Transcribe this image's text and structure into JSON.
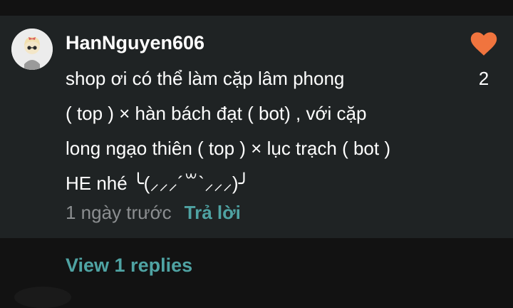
{
  "comment": {
    "username": "HanNguyen606",
    "body_lines": [
      "shop ơi có thể làm cặp lâm phong",
      "( top ) × hàn bách đạt ( bot) , với cặp",
      "long ngạo thiên ( top ) × lục trạch ( bot )",
      "HE nhé  ╰(⸝⸝⸝´꒳`⸝⸝⸝)╯"
    ],
    "timestamp": "1 ngày trước",
    "reply_label": "Trả lời",
    "like_count": "2",
    "view_replies_label": "View 1 replies"
  },
  "colors": {
    "background": "#121212",
    "card": "#1f2324",
    "accent_teal": "#4fa3a3",
    "heart": "#f0743e",
    "muted_text": "#8c8f91"
  },
  "icons": {
    "like": "heart-icon",
    "avatar": "user-avatar"
  }
}
